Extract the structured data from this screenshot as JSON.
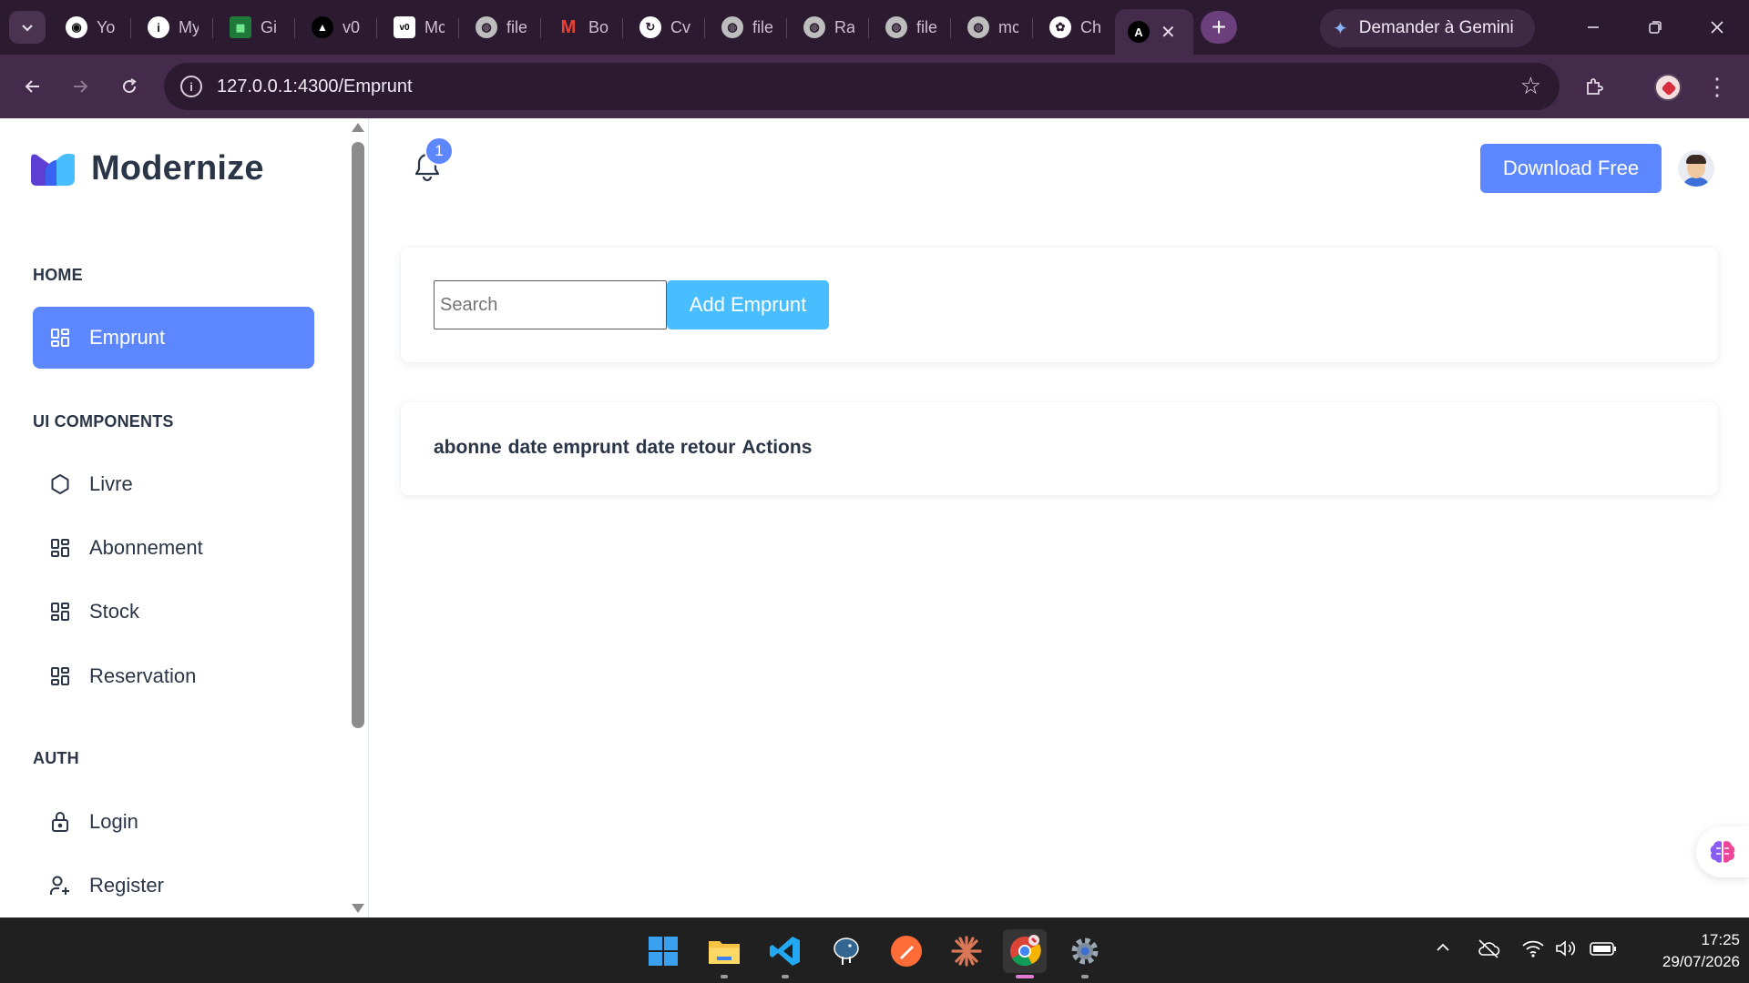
{
  "browser": {
    "tabs": [
      {
        "label": "Yo",
        "icon": "github-icon",
        "color": "#ffffff"
      },
      {
        "label": "My",
        "icon": "info-icon",
        "color": "#ffffff"
      },
      {
        "label": "Gi",
        "icon": "grid-sheet-icon",
        "color": "#27b24a"
      },
      {
        "label": "v0",
        "icon": "vercel-triangle-icon",
        "color": "#000000"
      },
      {
        "label": "Mc",
        "icon": "v0-icon",
        "color": "#ffffff"
      },
      {
        "label": "file",
        "icon": "globe-icon",
        "color": "#d0d0d0"
      },
      {
        "label": "Bo",
        "icon": "gmail-icon",
        "color": "#ea4335"
      },
      {
        "label": "Cv",
        "icon": "refresh-circle-icon",
        "color": "#ffffff"
      },
      {
        "label": "file",
        "icon": "globe-icon",
        "color": "#d0d0d0"
      },
      {
        "label": "Ra",
        "icon": "globe-icon",
        "color": "#d0d0d0"
      },
      {
        "label": "file",
        "icon": "globe-icon",
        "color": "#d0d0d0"
      },
      {
        "label": "mc",
        "icon": "globe-icon",
        "color": "#d0d0d0"
      },
      {
        "label": "Ch",
        "icon": "openai-icon",
        "color": "#ffffff"
      }
    ],
    "active_tab_icon_letter": "A",
    "active_tab_close": "✕",
    "new_tab": "+",
    "gemini_label": "Demander à Gemini",
    "url": "127.0.0.1:4300/Emprunt"
  },
  "sidebar": {
    "brand": "Modernize",
    "sections": {
      "home": "HOME",
      "ui": "UI COMPONENTS",
      "auth": "AUTH"
    },
    "items": [
      {
        "label": "Emprunt",
        "icon": "layout-dashboard-icon",
        "active": true
      },
      {
        "label": "Livre",
        "icon": "circle-icon",
        "active": false
      },
      {
        "label": "Abonnement",
        "icon": "layout-dashboard-icon",
        "active": false
      },
      {
        "label": "Stock",
        "icon": "layout-dashboard-icon",
        "active": false
      },
      {
        "label": "Reservation",
        "icon": "layout-dashboard-icon",
        "active": false
      },
      {
        "label": "Login",
        "icon": "lock-icon",
        "active": false
      },
      {
        "label": "Register",
        "icon": "user-plus-icon",
        "active": false
      }
    ]
  },
  "header": {
    "notification_count": "1",
    "download_label": "Download Free"
  },
  "main": {
    "search_placeholder": "Search",
    "add_label": "Add Emprunt",
    "table_columns": [
      "abonne",
      "date emprunt",
      "date retour",
      "Actions"
    ]
  },
  "taskbar": {
    "time": "17:25",
    "date": "29/07/2026"
  },
  "colors": {
    "primary": "#5d87ff",
    "secondary": "#49beff",
    "chrome_dark": "#2c1a31",
    "chrome_toolbar": "#442b4b",
    "text": "#2a3547"
  }
}
